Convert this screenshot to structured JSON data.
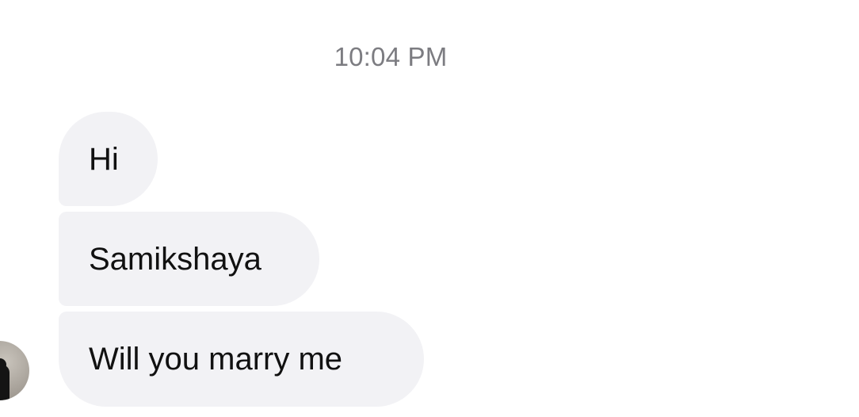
{
  "thread": {
    "timestamp": "10:04 PM",
    "messages": [
      {
        "text": "Hi"
      },
      {
        "text": "Samikshaya"
      },
      {
        "text": "Will you marry me"
      }
    ]
  },
  "colors": {
    "bubble_background": "#f2f2f5",
    "timestamp_text": "#7c7c81",
    "message_text": "#111111"
  },
  "icons": {
    "avatar": "contact-avatar"
  }
}
